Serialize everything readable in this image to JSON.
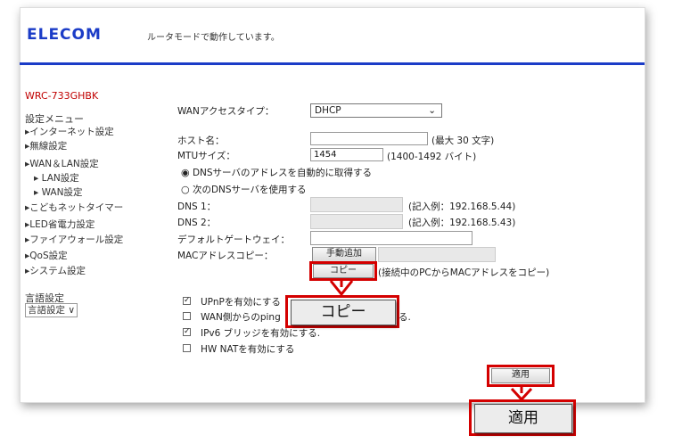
{
  "header": {
    "logo": "ELECOM",
    "status": "ルータモードで動作しています。"
  },
  "sidebar": {
    "model": "WRC-733GHBK",
    "menu_title": "設定メニュー",
    "items": [
      {
        "label": "▸インターネット設定"
      },
      {
        "label": "▸無線設定"
      },
      {
        "label": "▸WAN＆LAN設定"
      },
      {
        "label": "▸ LAN設定"
      },
      {
        "label": "▸ WAN設定"
      },
      {
        "label": "▸こどもネットタイマー"
      },
      {
        "label": "▸LED省電力設定"
      },
      {
        "label": "▸ファイアウォール設定"
      },
      {
        "label": "▸QoS設定"
      },
      {
        "label": "▸システム設定"
      }
    ],
    "lang_title": "言語設定",
    "lang_select": "言語設定 ∨"
  },
  "form": {
    "wan_type_label": "WANアクセスタイプ：",
    "wan_type_value": "DHCP",
    "hostname_label": "ホスト名：",
    "hostname_value": "",
    "hostname_hint": "(最大 30 文字)",
    "mtu_label": "MTUサイズ：",
    "mtu_value": "1454",
    "mtu_hint": "(1400-1492 バイト)",
    "dns_auto_label": "DNSサーバのアドレスを自動的に取得する",
    "dns_manual_label": "次のDNSサーバを使用する",
    "dns1_label": "DNS 1：",
    "dns1_hint": "(記入例：192.168.5.44)",
    "dns2_label": "DNS 2：",
    "dns2_hint": "(記入例：192.168.5.43)",
    "gateway_label": "デフォルトゲートウェイ：",
    "mac_label": "MACアドレスコピー：",
    "mac_manual_button": "手動追加",
    "copy_button": "コピー",
    "copy_hint": "(接続中のPCからMACアドレスをコピー)",
    "upnp_label": "UPnPを有効にする",
    "ping_label": "WAN側からのping",
    "ping_label_tail": "る.",
    "ipv6_label": "IPv6 ブリッジを有効にする.",
    "hwnat_label": "HW NATを有効にする",
    "apply_button": "適用"
  },
  "callouts": {
    "copy_large": "コピー",
    "apply_large": "適用"
  },
  "colors": {
    "brand": "#1b3cc7",
    "model_text": "#c00000",
    "highlight": "#d40000"
  }
}
